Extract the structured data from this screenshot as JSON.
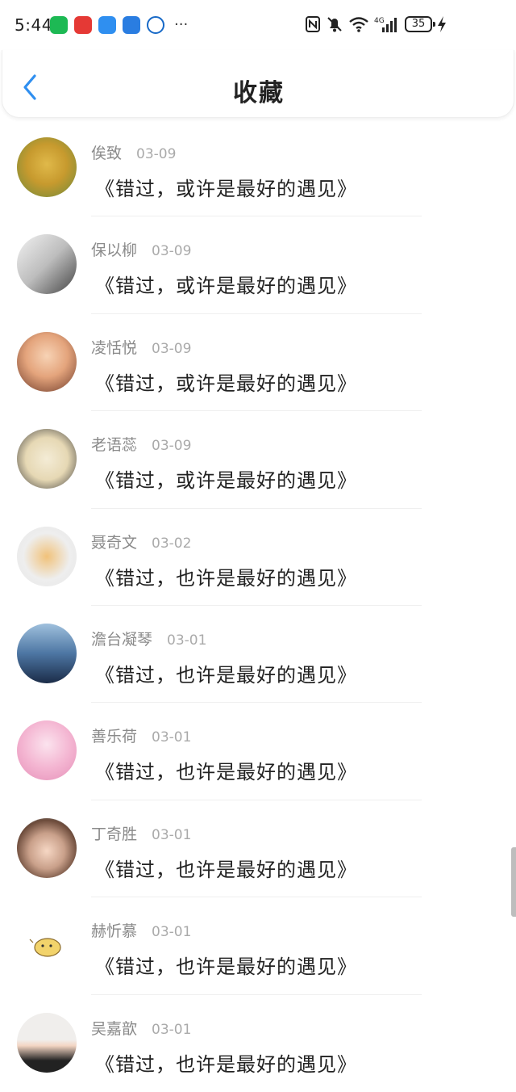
{
  "status_bar": {
    "time": "5:44",
    "more_indicator": "···",
    "battery_level": "35",
    "notification_icons": [
      {
        "name": "green-app-icon",
        "color": "#1db954"
      },
      {
        "name": "huawei-app-icon",
        "color": "#e53935"
      },
      {
        "name": "message-app-icon",
        "color": "#2f8ff0"
      },
      {
        "name": "cloud-app-icon",
        "color": "#2a7de1"
      },
      {
        "name": "pay-app-icon",
        "color": "#1769c7"
      }
    ]
  },
  "header": {
    "title": "收藏",
    "accent_color": "#2f8ff0"
  },
  "items": [
    {
      "name": "俟致",
      "date": "03-09",
      "title": "《错过，或许是最好的遇见》",
      "avatar_colors": [
        "#e0b94a",
        "#6b8a3c"
      ]
    },
    {
      "name": "保以柳",
      "date": "03-09",
      "title": "《错过，或许是最好的遇见》",
      "avatar_colors": [
        "#d9d9d9",
        "#555555"
      ]
    },
    {
      "name": "凌恬悦",
      "date": "03-09",
      "title": "《错过，或许是最好的遇见》",
      "avatar_colors": [
        "#f3c29e",
        "#6e3b2a"
      ]
    },
    {
      "name": "老语蕊",
      "date": "03-09",
      "title": "《错过，或许是最好的遇见》",
      "avatar_colors": [
        "#f0e6cc",
        "#3a3a3a"
      ]
    },
    {
      "name": "聂奇文",
      "date": "03-02",
      "title": "《错过，也许是最好的遇见》",
      "avatar_colors": [
        "#eeeeee",
        "#e8a04a"
      ]
    },
    {
      "name": "澹台凝琴",
      "date": "03-01",
      "title": "《错过，也许是最好的遇见》",
      "avatar_colors": [
        "#7aa3c9",
        "#1b2c48"
      ]
    },
    {
      "name": "善乐荷",
      "date": "03-01",
      "title": "《错过，也许是最好的遇见》",
      "avatar_colors": [
        "#f4b6d2",
        "#e58fb8"
      ]
    },
    {
      "name": "丁奇胜",
      "date": "03-01",
      "title": "《错过，也许是最好的遇见》",
      "avatar_colors": [
        "#b7e3f3",
        "#6b4a3a"
      ]
    },
    {
      "name": "赫忻慕",
      "date": "03-01",
      "title": "《错过，也许是最好的遇见》",
      "avatar_colors": [
        "#ffffff",
        "#f2d36b"
      ]
    },
    {
      "name": "吴嘉歆",
      "date": "03-01",
      "title": "《错过，也许是最好的遇见》",
      "avatar_colors": [
        "#f0eeec",
        "#222222"
      ]
    }
  ]
}
